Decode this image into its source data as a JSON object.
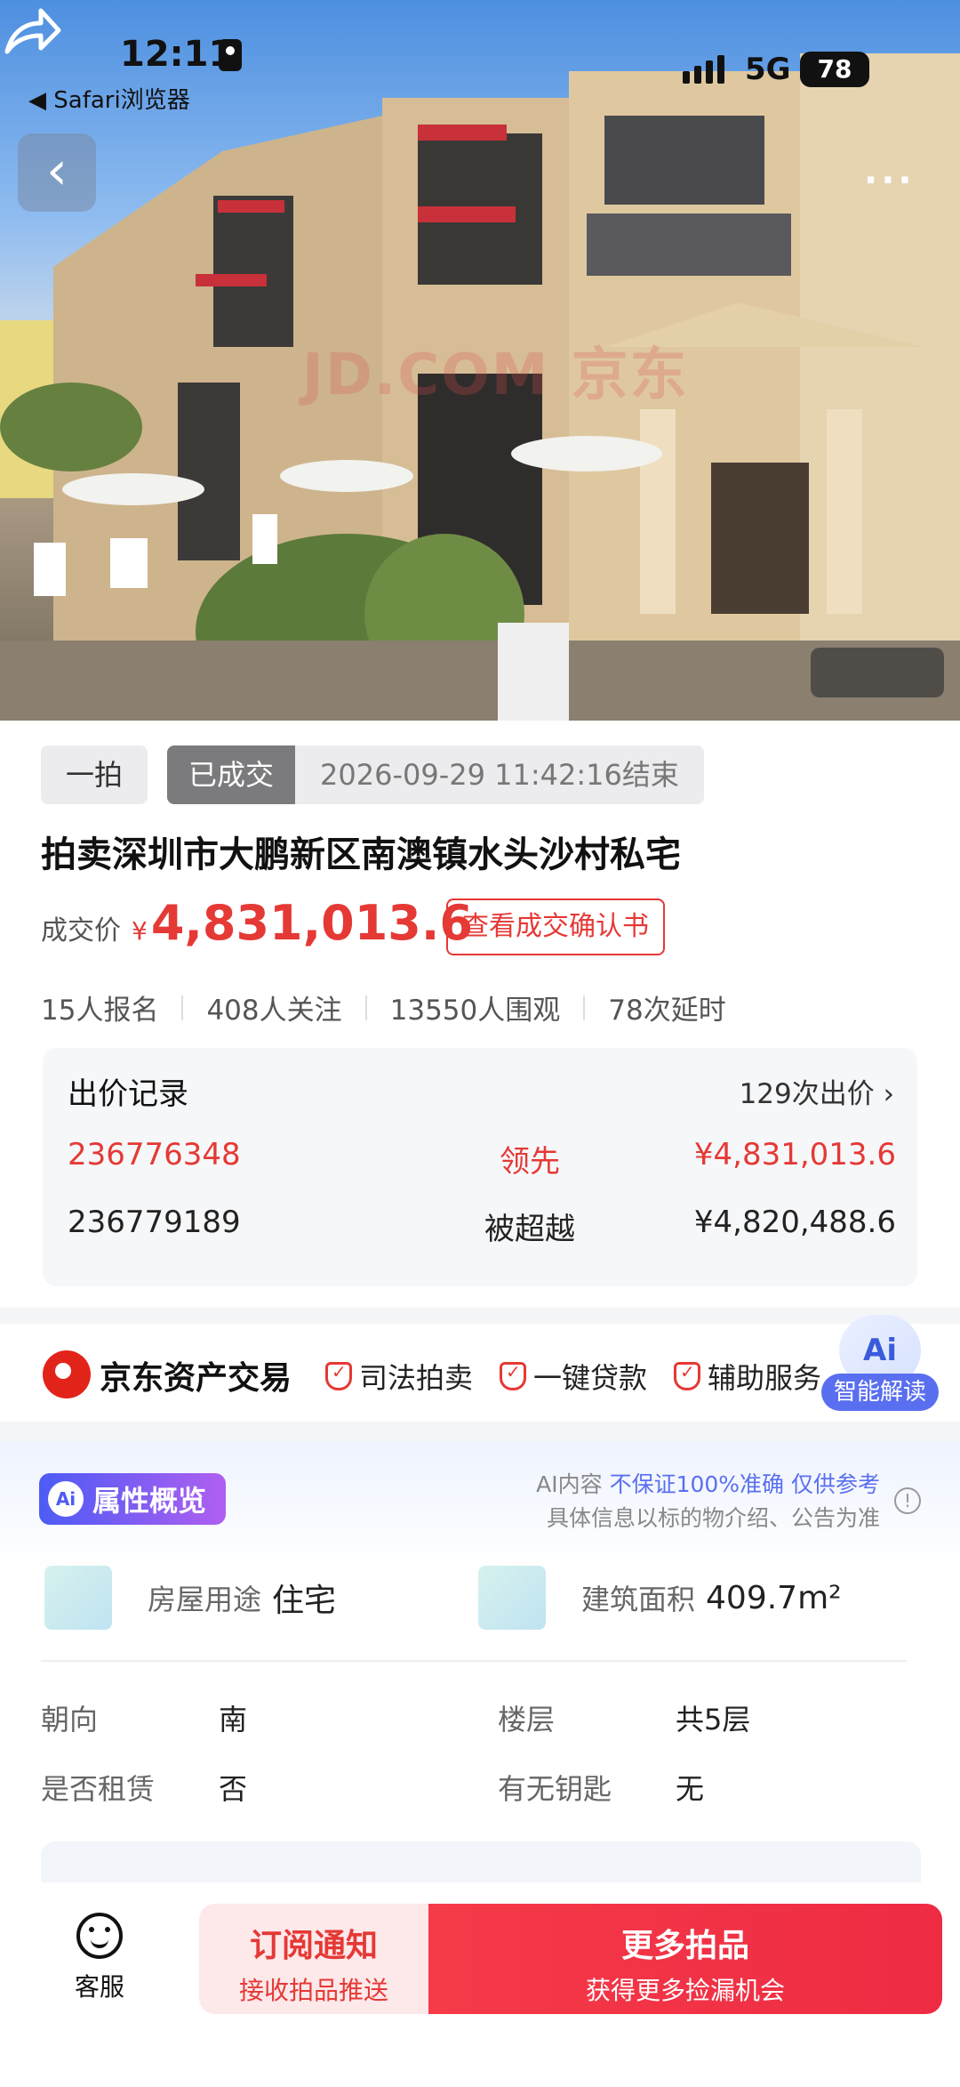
{
  "status_bar": {
    "time": "12:11",
    "back_app": "◀ Safari浏览器",
    "network": "5G",
    "battery": "78"
  },
  "nav": {
    "back": "‹",
    "more": "···"
  },
  "hero": {
    "watermark": "JD.COM 京东"
  },
  "auction": {
    "round": "一拍",
    "status": "已成交",
    "end_time": "2026-09-29 11:42:16结束",
    "title": "拍卖深圳市大鹏新区南澳镇水头沙村私宅",
    "price_label": "成交价",
    "currency": "¥",
    "price": "4,831,013.6",
    "confirm_button": "查看成交确认书",
    "stats": [
      "15人报名",
      "408人关注",
      "13550人围观",
      "78次延时"
    ]
  },
  "bids": {
    "title": "出价记录",
    "count": "129次出价 ›",
    "rows": [
      {
        "bidder": "236776348",
        "status": "领先",
        "amount": "¥4,831,013.6"
      },
      {
        "bidder": "236779189",
        "status": "被超越",
        "amount": "¥4,820,488.6"
      }
    ]
  },
  "services": {
    "brand": "京东资产交易",
    "items": [
      "司法拍卖",
      "一键贷款",
      "辅助服务"
    ],
    "ai_badge": "Ai",
    "ai_label": "智能解读"
  },
  "attributes": {
    "tag": "属性概览",
    "tag_icon": "Ai",
    "disclaimer_prefix": "AI内容 ",
    "disclaimer_highlight": "不保证100%准确 仅供参考",
    "disclaimer_line2": "具体信息以标的物介绍、公告为准",
    "usage_label": "房屋用途",
    "usage_value": "住宅",
    "area_label": "建筑面积",
    "area_value": "409.7m²",
    "orientation_label": "朝向",
    "orientation_value": "南",
    "floor_label": "楼层",
    "floor_value": "共5层",
    "rented_label": "是否租赁",
    "rented_value": "否",
    "keys_label": "有无钥匙",
    "keys_value": "无"
  },
  "bottom": {
    "service_label": "客服",
    "subscribe_main": "订阅通知",
    "subscribe_sub": "接收拍品推送",
    "more_main": "更多拍品",
    "more_sub": "获得更多捡漏机会"
  },
  "colors": {
    "accent": "#e53935",
    "ai": "#5a6ff0"
  }
}
